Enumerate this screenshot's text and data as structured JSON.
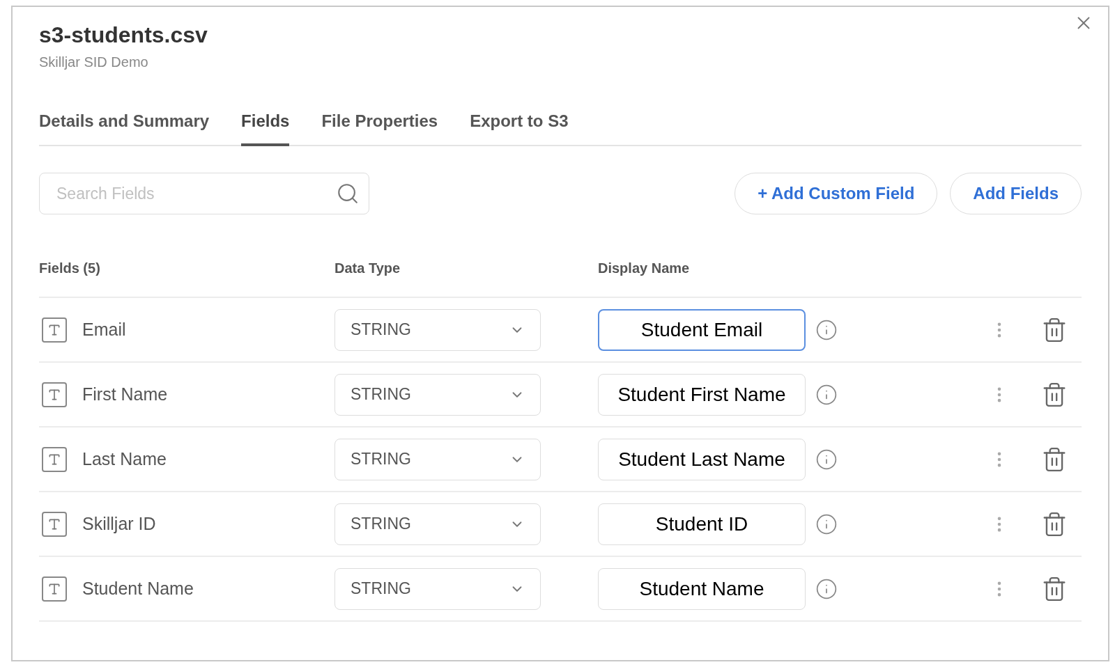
{
  "dialog": {
    "title": "s3-students.csv",
    "subtitle": "Skilljar SID Demo"
  },
  "tabs": [
    {
      "label": "Details and Summary",
      "selected": false
    },
    {
      "label": "Fields",
      "selected": true
    },
    {
      "label": "File Properties",
      "selected": false
    },
    {
      "label": "Export to S3",
      "selected": false
    }
  ],
  "search": {
    "placeholder": "Search Fields"
  },
  "buttons": [
    {
      "label": "+ Add Custom Field"
    },
    {
      "label": "Add Fields"
    }
  ],
  "table": {
    "columns": [
      "Fields (5)",
      "Data Type",
      "Display Name"
    ],
    "rows": [
      {
        "field": "Email",
        "data_type": "STRING",
        "display_name": "Student Email",
        "focused": true
      },
      {
        "field": "First Name",
        "data_type": "STRING",
        "display_name": "Student First Name",
        "focused": false
      },
      {
        "field": "Last Name",
        "data_type": "STRING",
        "display_name": "Student Last Name",
        "focused": false
      },
      {
        "field": "Skilljar ID",
        "data_type": "STRING",
        "display_name": "Student ID",
        "focused": false
      },
      {
        "field": "Student Name",
        "data_type": "STRING",
        "display_name": "Student Name",
        "focused": false
      }
    ]
  }
}
